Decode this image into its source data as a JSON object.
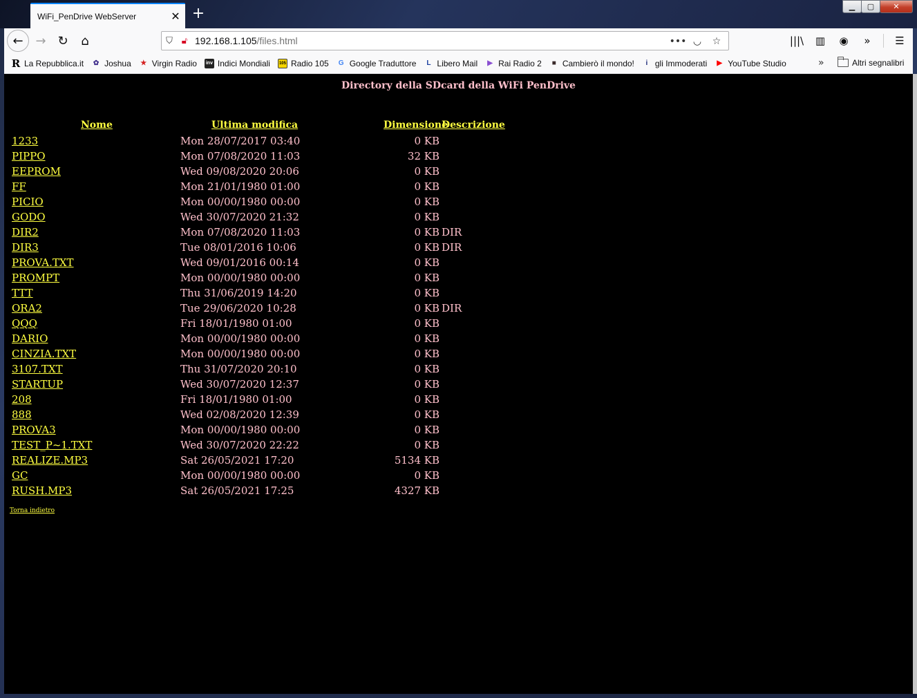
{
  "browser": {
    "tab_title": "WiFi_PenDrive WebServer",
    "url_host": "192.168.1.105",
    "url_path": "/files.html",
    "bookmarks": [
      {
        "label": "La Repubblica.it",
        "icon": "R",
        "color": "#000000"
      },
      {
        "label": "Joshua",
        "icon": "✿",
        "color": "#3d2a8a"
      },
      {
        "label": "Virgin Radio",
        "icon": "★",
        "color": "#d42020"
      },
      {
        "label": "Indici Mondiali",
        "icon": "inv",
        "color": "#222222"
      },
      {
        "label": "Radio 105",
        "icon": "105",
        "color": "#d8b400"
      },
      {
        "label": "Google Traduttore",
        "icon": "G",
        "color": "#4285f4"
      },
      {
        "label": "Libero Mail",
        "icon": "L",
        "color": "#1a3fa0"
      },
      {
        "label": "Rai Radio 2",
        "icon": "▶",
        "color": "#8a4fd1"
      },
      {
        "label": "Cambierò il mondo!",
        "icon": "■",
        "color": "#3a2a2a"
      },
      {
        "label": "gli Immoderati",
        "icon": "i",
        "color": "#1d2a7a"
      },
      {
        "label": "YouTube Studio",
        "icon": "▶",
        "color": "#ff0000"
      }
    ],
    "other_bookmarks": "Altri segnalibri"
  },
  "page": {
    "heading": "Directory della SDcard della WiFi PenDrive",
    "columns": {
      "name": "Nome",
      "modified": "Ultima modifica",
      "size": "Dimensione",
      "description": "Descrizione"
    },
    "files": [
      {
        "name": "1233",
        "date": "Mon 28/07/2017 03:40",
        "size": "0 KB",
        "desc": ""
      },
      {
        "name": "PIPPO",
        "date": "Mon 07/08/2020 11:03",
        "size": "32 KB",
        "desc": ""
      },
      {
        "name": "EEPROM",
        "date": "Wed 09/08/2020 20:06",
        "size": "0 KB",
        "desc": ""
      },
      {
        "name": "FF",
        "date": "Mon 21/01/1980 01:00",
        "size": "0 KB",
        "desc": ""
      },
      {
        "name": "PICIO",
        "date": "Mon 00/00/1980 00:00",
        "size": "0 KB",
        "desc": ""
      },
      {
        "name": "GODO",
        "date": "Wed 30/07/2020 21:32",
        "size": "0 KB",
        "desc": ""
      },
      {
        "name": "DIR2",
        "date": "Mon 07/08/2020 11:03",
        "size": "0 KB",
        "desc": "DIR"
      },
      {
        "name": "DIR3",
        "date": "Tue 08/01/2016 10:06",
        "size": "0 KB",
        "desc": "DIR"
      },
      {
        "name": "PROVA.TXT",
        "date": "Wed 09/01/2016 00:14",
        "size": "0 KB",
        "desc": ""
      },
      {
        "name": "PROMPT",
        "date": "Mon 00/00/1980 00:00",
        "size": "0 KB",
        "desc": ""
      },
      {
        "name": "TTT",
        "date": "Thu 31/06/2019 14:20",
        "size": "0 KB",
        "desc": ""
      },
      {
        "name": "ORA2",
        "date": "Tue 29/06/2020 10:28",
        "size": "0 KB",
        "desc": "DIR"
      },
      {
        "name": "QQQ",
        "date": "Fri 18/01/1980 01:00",
        "size": "0 KB",
        "desc": ""
      },
      {
        "name": "DARIO",
        "date": "Mon 00/00/1980 00:00",
        "size": "0 KB",
        "desc": ""
      },
      {
        "name": "CINZIA.TXT",
        "date": "Mon 00/00/1980 00:00",
        "size": "0 KB",
        "desc": ""
      },
      {
        "name": "3107.TXT",
        "date": "Thu 31/07/2020 20:10",
        "size": "0 KB",
        "desc": ""
      },
      {
        "name": "STARTUP",
        "date": "Wed 30/07/2020 12:37",
        "size": "0 KB",
        "desc": ""
      },
      {
        "name": "208",
        "date": "Fri 18/01/1980 01:00",
        "size": "0 KB",
        "desc": ""
      },
      {
        "name": "888",
        "date": "Wed 02/08/2020 12:39",
        "size": "0 KB",
        "desc": ""
      },
      {
        "name": "PROVA3",
        "date": "Mon 00/00/1980 00:00",
        "size": "0 KB",
        "desc": ""
      },
      {
        "name": "TEST_P~1.TXT",
        "date": "Wed 30/07/2020 22:22",
        "size": "0 KB",
        "desc": ""
      },
      {
        "name": "REALIZE.MP3",
        "date": "Sat 26/05/2021 17:20",
        "size": "5134 KB",
        "desc": ""
      },
      {
        "name": "GC",
        "date": "Mon 00/00/1980 00:00",
        "size": "0 KB",
        "desc": ""
      },
      {
        "name": "RUSH.MP3",
        "date": "Sat 26/05/2021 17:25",
        "size": "4327 KB",
        "desc": ""
      }
    ],
    "back_link": "Torna indietro"
  },
  "colors": {
    "link": "#ffff40",
    "text": "#ffc0cb",
    "background": "#000000"
  }
}
